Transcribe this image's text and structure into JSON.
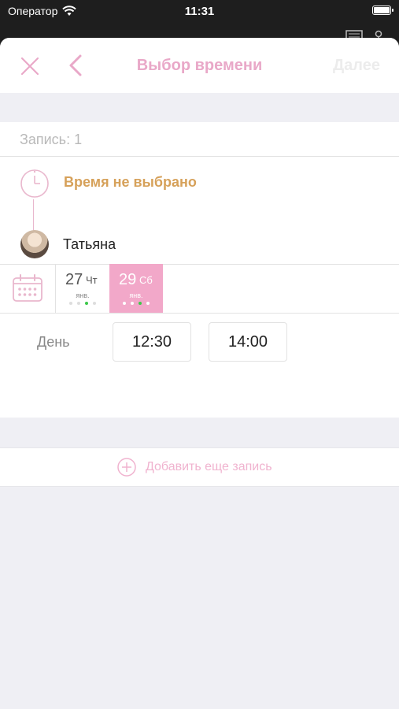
{
  "status_bar": {
    "carrier": "Оператор",
    "time": "11:31"
  },
  "nav": {
    "title": "Выбор времени",
    "next_label": "Далее"
  },
  "booking": {
    "record_label": "Запись: 1",
    "time_status": "Время не выбрано",
    "master_name": "Татьяна"
  },
  "calendar": {
    "days": [
      {
        "num": "27",
        "weekday": "Чт",
        "month": "янв.",
        "selected": false
      },
      {
        "num": "29",
        "weekday": "Сб",
        "month": "янв.",
        "selected": true
      }
    ]
  },
  "slots": {
    "period_label": "День",
    "times": [
      "12:30",
      "14:00"
    ]
  },
  "add_record": {
    "label": "Добавить еще запись"
  },
  "colors": {
    "accent_pink": "#e9a8c8",
    "selected_day": "#f2a8c9",
    "status_orange": "#d6a15a",
    "available_dot": "#3cc84a"
  }
}
